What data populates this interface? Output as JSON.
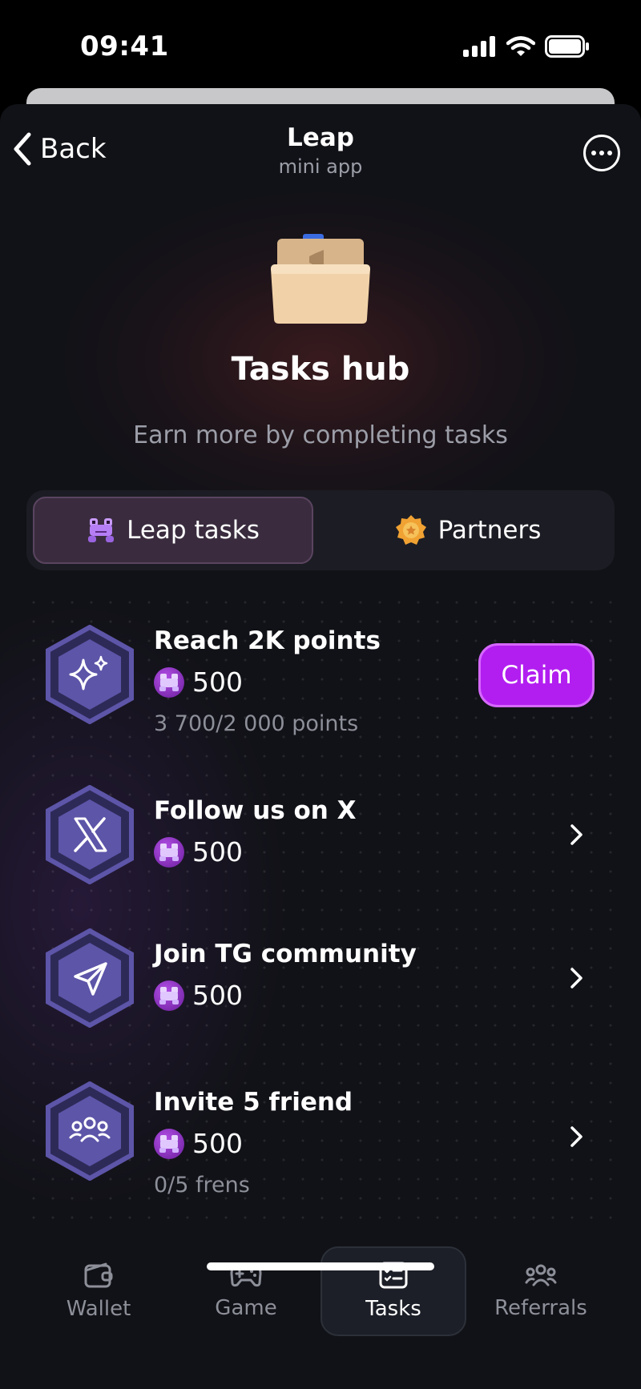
{
  "status": {
    "time": "09:41"
  },
  "nav": {
    "back_label": "Back",
    "title": "Leap",
    "subtitle": "mini app"
  },
  "hero": {
    "title": "Tasks hub",
    "subtitle": "Earn more by completing tasks"
  },
  "segment": {
    "tabs": [
      {
        "label": "Leap tasks",
        "active": true
      },
      {
        "label": "Partners",
        "active": false
      }
    ]
  },
  "tasks": [
    {
      "title": "Reach 2K points",
      "reward": "500",
      "progress": "3 700/2 000 points",
      "action": "Claim",
      "icon": "sparkles-icon"
    },
    {
      "title": "Follow us on X",
      "reward": "500",
      "icon": "x-logo-icon"
    },
    {
      "title": "Join TG community",
      "reward": "500",
      "icon": "paper-plane-icon"
    },
    {
      "title": "Invite 5 friend",
      "reward": "500",
      "progress": "0/5 frens",
      "icon": "friends-icon"
    }
  ],
  "tabbar": {
    "items": [
      {
        "label": "Wallet",
        "icon": "wallet-icon"
      },
      {
        "label": "Game",
        "icon": "gamepad-icon"
      },
      {
        "label": "Tasks",
        "icon": "tasks-icon",
        "active": true
      },
      {
        "label": "Referrals",
        "icon": "referrals-icon"
      }
    ]
  },
  "colors": {
    "background": "#111217",
    "accent": "#b21ef0",
    "hex": "#5d55a8",
    "muted": "#8d8f99"
  }
}
